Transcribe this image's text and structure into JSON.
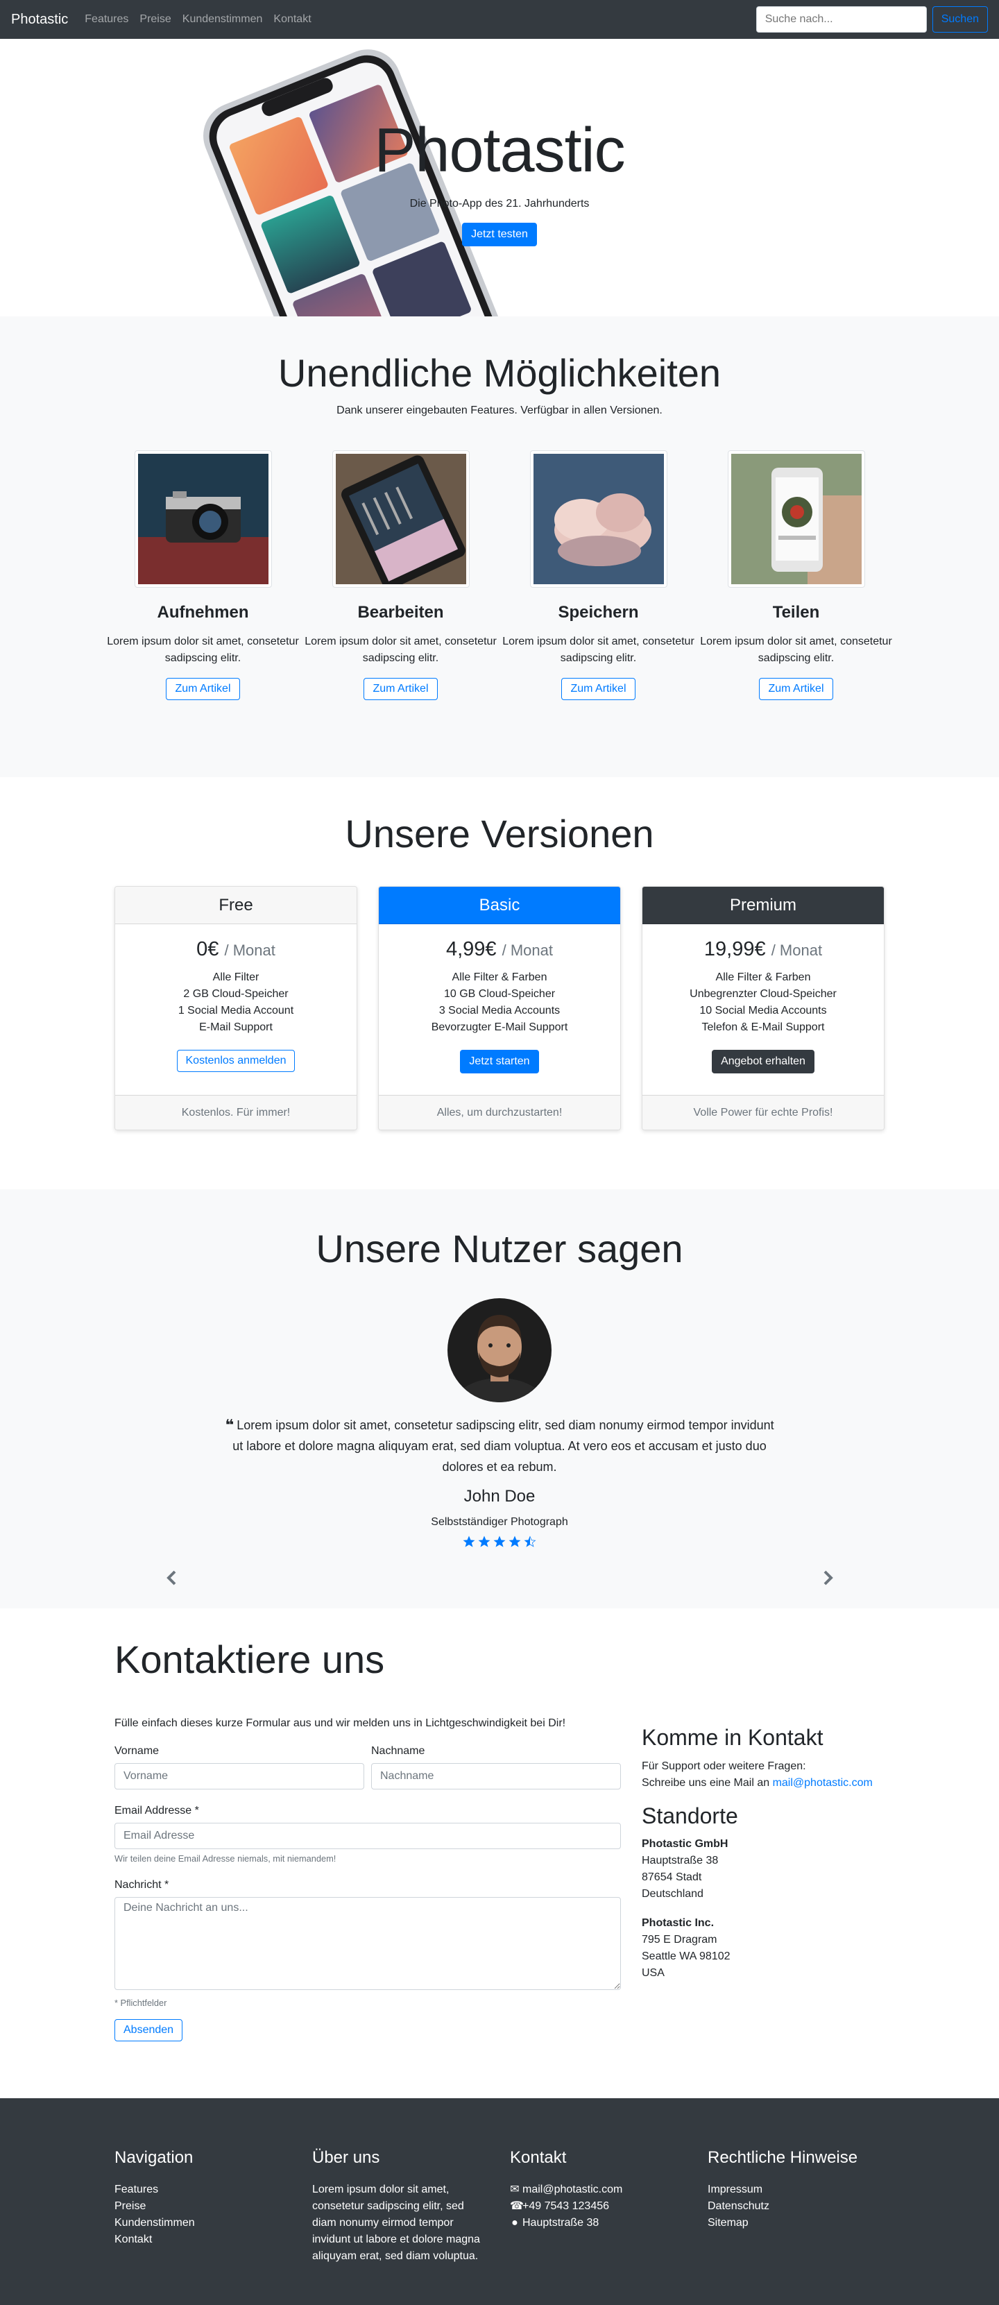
{
  "nav": {
    "brand": "Photastic",
    "links": [
      "Features",
      "Preise",
      "Kundenstimmen",
      "Kontakt"
    ],
    "search_placeholder": "Suche nach...",
    "search_button": "Suchen"
  },
  "hero": {
    "title": "Photastic",
    "subtitle": "Die Photo-App des 21. Jahrhunderts",
    "cta": "Jetzt testen"
  },
  "features": {
    "title": "Unendliche Möglichkeiten",
    "lead": "Dank unserer eingebauten Features. Verfügbar in allen Versionen.",
    "items": [
      {
        "name": "Aufnehmen",
        "text": "Lorem ipsum dolor sit amet, consetetur sadipscing elitr.",
        "button": "Zum Artikel"
      },
      {
        "name": "Bearbeiten",
        "text": "Lorem ipsum dolor sit amet, consetetur sadipscing elitr.",
        "button": "Zum Artikel"
      },
      {
        "name": "Speichern",
        "text": "Lorem ipsum dolor sit amet, consetetur sadipscing elitr.",
        "button": "Zum Artikel"
      },
      {
        "name": "Teilen",
        "text": "Lorem ipsum dolor sit amet, consetetur sadipscing elitr.",
        "button": "Zum Artikel"
      }
    ]
  },
  "pricing": {
    "title": "Unsere Versionen",
    "plans": [
      {
        "name": "Free",
        "price": "0€",
        "period": "/ Monat",
        "features": [
          "Alle Filter",
          "2 GB Cloud-Speicher",
          "1 Social Media Account",
          "E-Mail Support"
        ],
        "button": "Kostenlos anmelden",
        "footer": "Kostenlos. Für immer!"
      },
      {
        "name": "Basic",
        "price": "4,99€",
        "period": "/ Monat",
        "features": [
          "Alle Filter & Farben",
          "10 GB Cloud-Speicher",
          "3 Social Media Accounts",
          "Bevorzugter E-Mail Support"
        ],
        "button": "Jetzt starten",
        "footer": "Alles, um durchzustarten!"
      },
      {
        "name": "Premium",
        "price": "19,99€",
        "period": "/ Monat",
        "features": [
          "Alle Filter & Farben",
          "Unbegrenzter Cloud-Speicher",
          "10 Social Media Accounts",
          "Telefon & E-Mail Support"
        ],
        "button": "Angebot erhalten",
        "footer": "Volle Power für echte Profis!"
      }
    ]
  },
  "testimonials": {
    "title": "Unsere Nutzer sagen",
    "quote": "Lorem ipsum dolor sit amet, consetetur sadipscing elitr, sed diam nonumy eirmod tempor invidunt ut labore et dolore magna aliquyam erat, sed diam voluptua. At vero eos et accusam et justo duo dolores et ea rebum.",
    "name": "John Doe",
    "role": "Selbstständiger Photograph",
    "rating": 4.5,
    "rating_max": 5
  },
  "contact": {
    "title": "Kontaktiere uns",
    "intro": "Fülle einfach dieses kurze Formular aus und wir melden uns in Lichtgeschwindigkeit bei Dir!",
    "firstname_label": "Vorname",
    "firstname_placeholder": "Vorname",
    "lastname_label": "Nachname",
    "lastname_placeholder": "Nachname",
    "email_label": "Email Addresse *",
    "email_placeholder": "Email Adresse",
    "email_help": "Wir teilen deine Email Adresse niemals, mit niemandem!",
    "message_label": "Nachricht *",
    "message_placeholder": "Deine Nachricht an uns...",
    "required_note": "* Pflichtfelder",
    "submit": "Absenden",
    "info_title": "Komme in Kontakt",
    "info_text": "Für Support oder weitere Fragen:",
    "info_text2": "Schreibe uns eine Mail an",
    "info_email": "mail@photastic.com",
    "locations_title": "Standorte",
    "locations": [
      {
        "company": "Photastic GmbH",
        "lines": [
          "Hauptstraße 38",
          "87654 Stadt",
          "Deutschland"
        ]
      },
      {
        "company": "Photastic Inc.",
        "lines": [
          "795 E Dragram",
          "Seattle WA 98102",
          "USA"
        ]
      }
    ]
  },
  "footer": {
    "nav_title": "Navigation",
    "nav_links": [
      "Features",
      "Preise",
      "Kundenstimmen",
      "Kontakt"
    ],
    "about_title": "Über uns",
    "about_text": "Lorem ipsum dolor sit amet, consetetur sadipscing elitr, sed diam nonumy eirmod tempor invidunt ut labore et dolore magna aliquyam erat, sed diam voluptua.",
    "contact_title": "Kontakt",
    "contact_email": "mail@photastic.com",
    "contact_phone": "+49 7543 123456",
    "contact_address": "Hauptstraße 38",
    "legal_title": "Rechtliche Hinweise",
    "legal_links": [
      "Impressum",
      "Datenschutz",
      "Sitemap"
    ]
  },
  "colors": {
    "primary": "#007bff",
    "dark": "#343a40",
    "light": "#f8f9fa"
  }
}
